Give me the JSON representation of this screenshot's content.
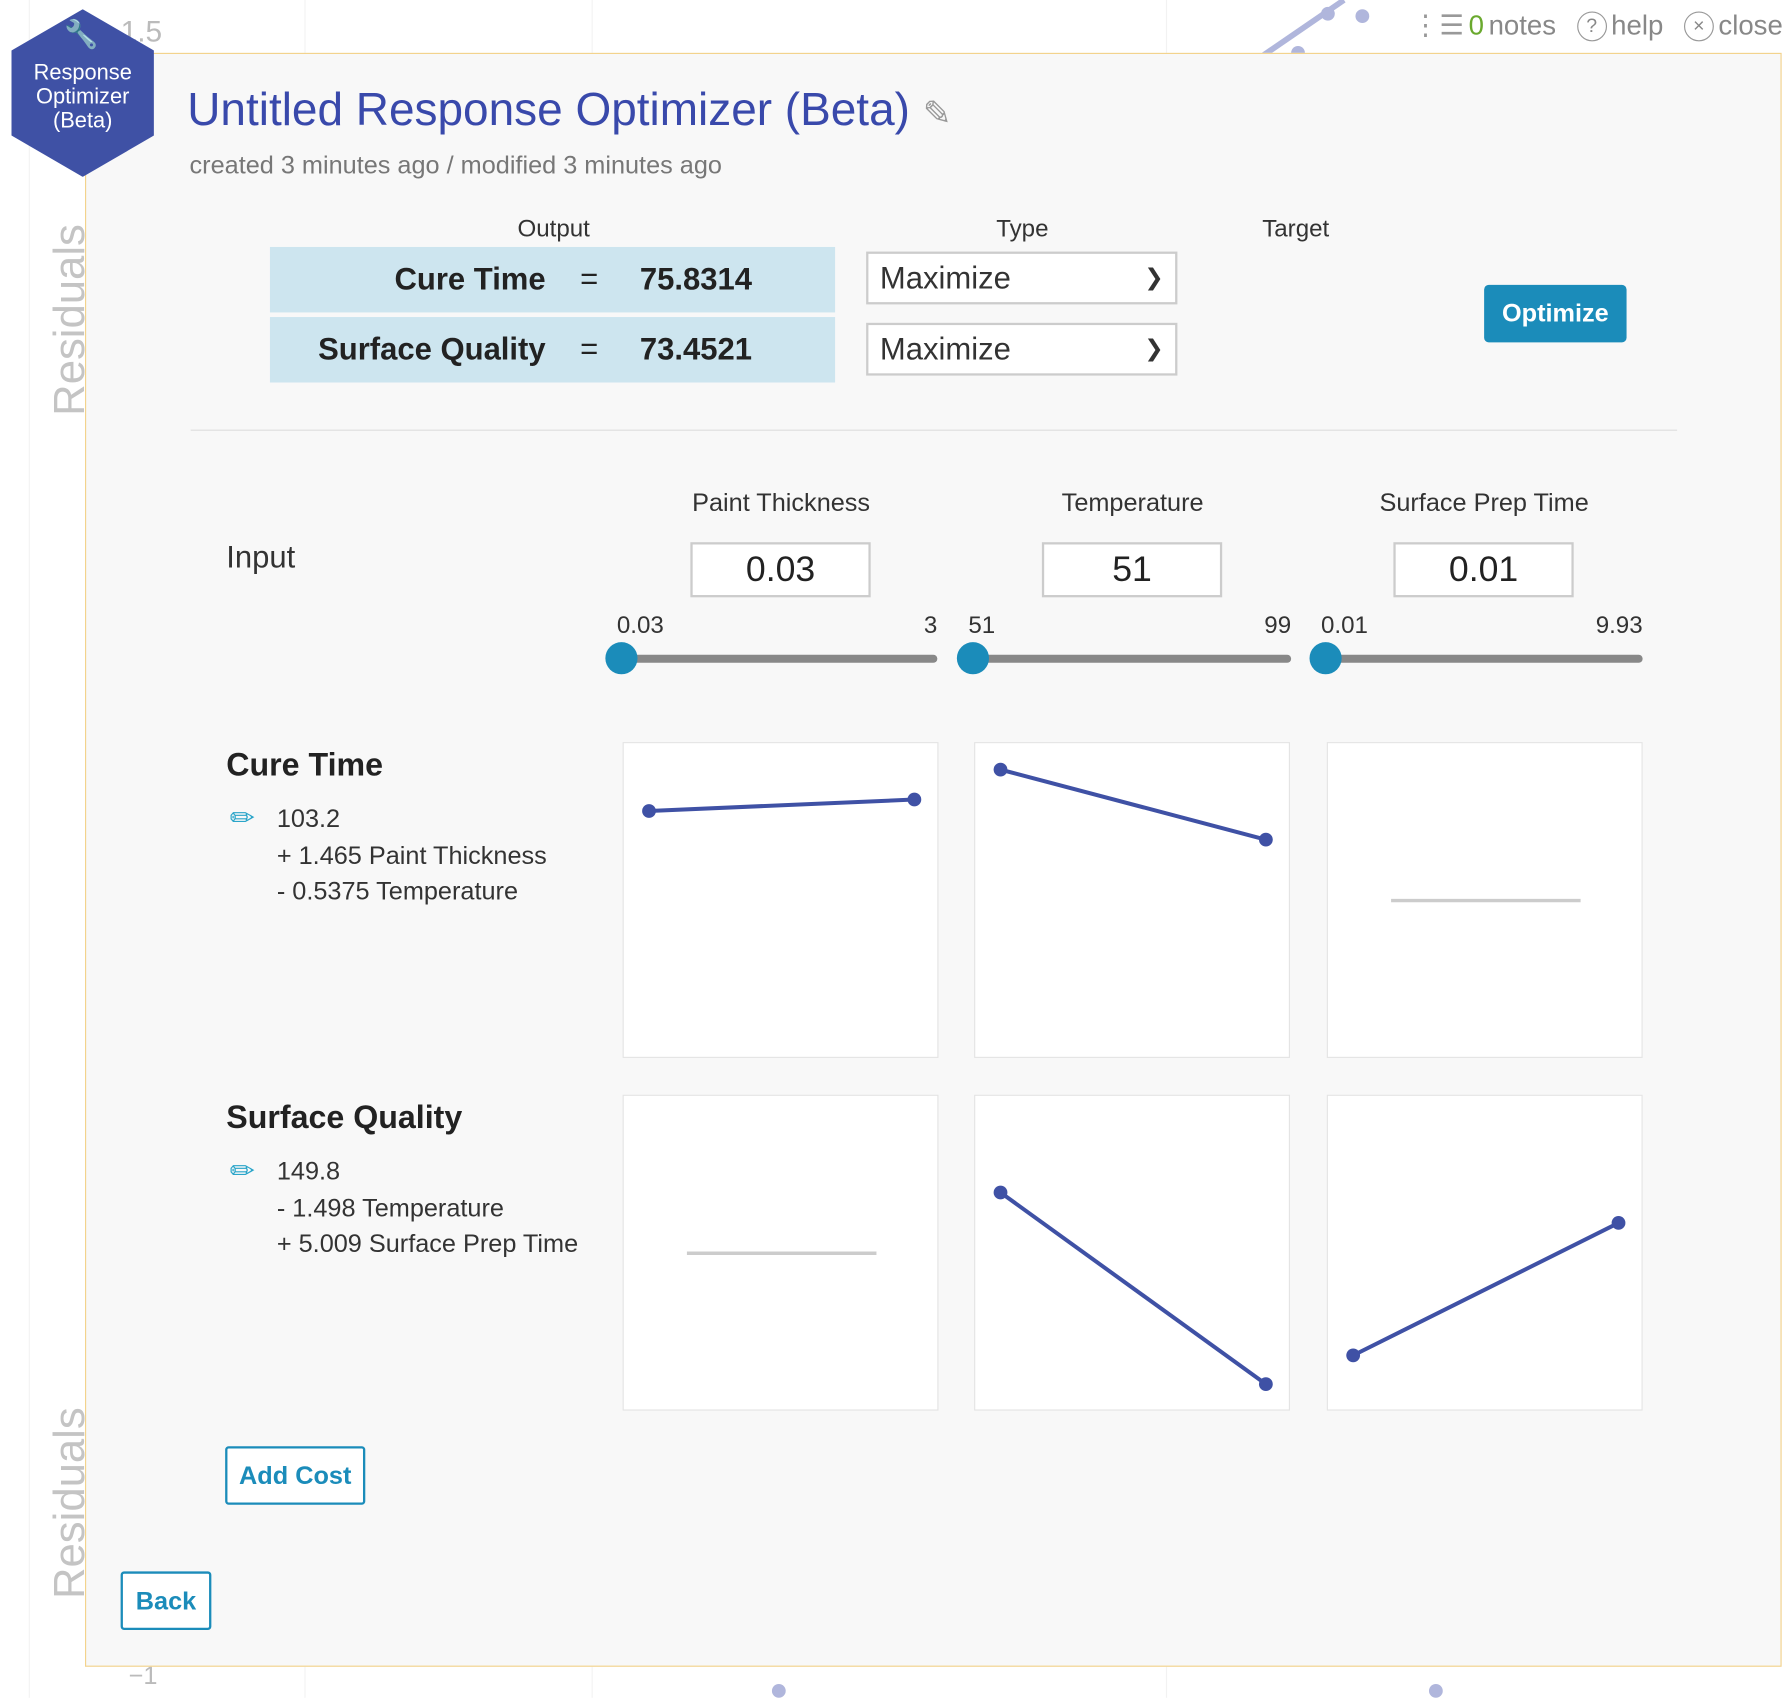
{
  "background": {
    "axis_tick_top": "1.5",
    "axis_tick_bottom": "−1",
    "axis_label": "Residuals"
  },
  "badge": {
    "line1": "Response",
    "line2": "Optimizer",
    "line3": "(Beta)",
    "color": "#3f51a5",
    "icon": "wrench-icon"
  },
  "topbar": {
    "notes_count": "0",
    "notes_label": "notes",
    "help_label": "help",
    "close_label": "close"
  },
  "header": {
    "title": "Untitled Response Optimizer (Beta)",
    "subtitle": "created 3 minutes ago / modified 3 minutes ago"
  },
  "outputs": {
    "headers": {
      "output": "Output",
      "type": "Type",
      "target": "Target"
    },
    "rows": [
      {
        "name": "Cure Time",
        "eq": "=",
        "value": "75.8314",
        "type": "Maximize"
      },
      {
        "name": "Surface Quality",
        "eq": "=",
        "value": "73.4521",
        "type": "Maximize"
      }
    ],
    "optimize_label": "Optimize"
  },
  "inputs": {
    "label": "Input",
    "factors": [
      {
        "name": "Paint Thickness",
        "value": "0.03",
        "min": "0.03",
        "max": "3",
        "slider_fraction": 0
      },
      {
        "name": "Temperature",
        "value": "51",
        "min": "51",
        "max": "99",
        "slider_fraction": 0
      },
      {
        "name": "Surface Prep Time",
        "value": "0.01",
        "min": "0.01",
        "max": "9.93",
        "slider_fraction": 0
      }
    ]
  },
  "responses": [
    {
      "name": "Cure Time",
      "equation": [
        "103.2",
        "+ 1.465 Paint Thickness",
        "- 0.5375 Temperature"
      ]
    },
    {
      "name": "Surface Quality",
      "equation": [
        "149.8",
        "- 1.498 Temperature",
        "+ 5.009 Surface Prep Time"
      ]
    }
  ],
  "chart_data": [
    {
      "type": "line",
      "response": "Cure Time",
      "factor": "Paint Thickness",
      "x": [
        0.03,
        3
      ],
      "y": [
        75.83,
        80.18
      ],
      "effect": true
    },
    {
      "type": "line",
      "response": "Cure Time",
      "factor": "Temperature",
      "x": [
        51,
        99
      ],
      "y": [
        75.83,
        50.03
      ],
      "effect": true
    },
    {
      "type": "line",
      "response": "Cure Time",
      "factor": "Surface Prep Time",
      "effect": false
    },
    {
      "type": "line",
      "response": "Surface Quality",
      "factor": "Paint Thickness",
      "effect": false
    },
    {
      "type": "line",
      "response": "Surface Quality",
      "factor": "Temperature",
      "x": [
        51,
        99
      ],
      "y": [
        73.45,
        1.55
      ],
      "effect": true
    },
    {
      "type": "line",
      "response": "Surface Quality",
      "factor": "Surface Prep Time",
      "x": [
        0.01,
        9.93
      ],
      "y": [
        73.45,
        123.14
      ],
      "effect": true
    }
  ],
  "colors": {
    "line": "#3f51a5",
    "no_effect": "#cccccc",
    "accent": "#1b8cba",
    "output_bg": "#cde5ef"
  },
  "buttons": {
    "add_cost": "Add Cost",
    "back": "Back"
  }
}
